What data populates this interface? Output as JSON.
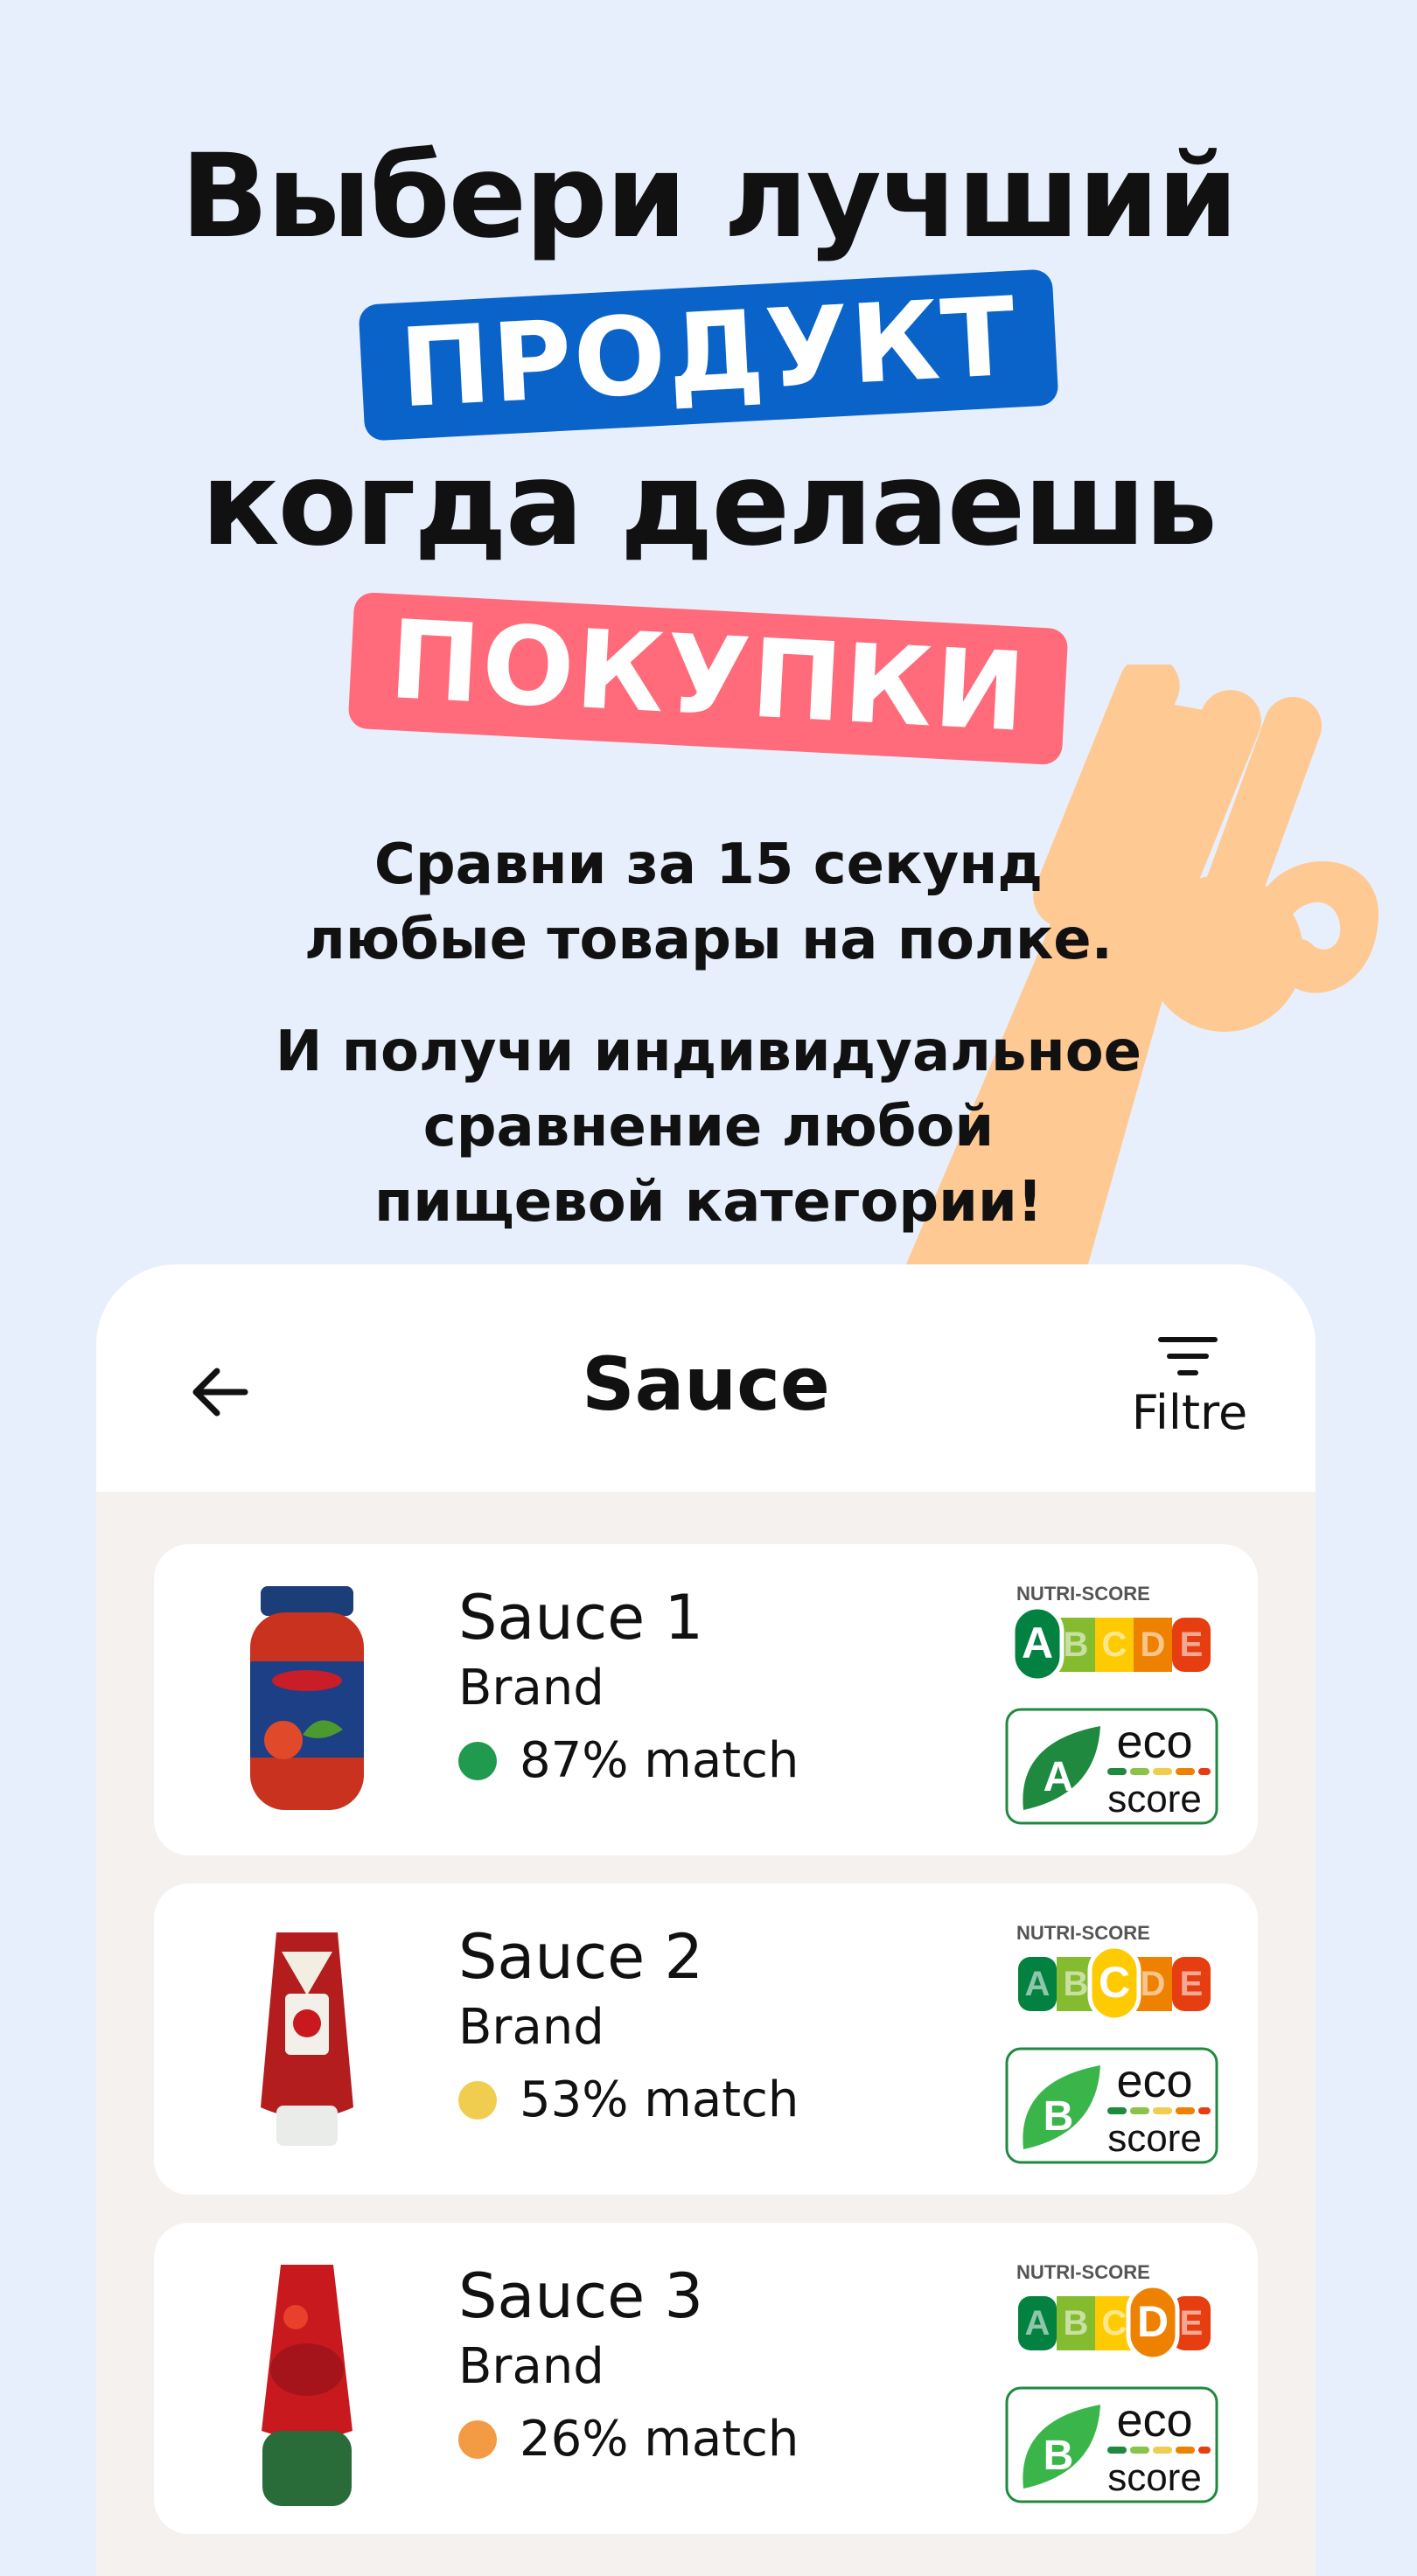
{
  "headline": {
    "line1": "Выбери лучший",
    "pill1": "ПРОДУКТ",
    "line3": "когда делаешь",
    "pill2": "ПОКУПКИ"
  },
  "subtitle1": [
    "Сравни за 15 секунд",
    "любые товары на полке."
  ],
  "subtitle2": [
    "И получи индивидуальное",
    "сравнение любой",
    "пищевой категории!"
  ],
  "colors": {
    "background": "#e8effc",
    "pill_blue": "#0a63c9",
    "pill_red": "#ff6b7a",
    "hand": "#fec992",
    "match_high": "#1f9a4f",
    "match_mid": "#f1cd4f",
    "match_low": "#f39a44"
  },
  "app": {
    "back_icon": "arrow-left-icon",
    "title": "Sauce",
    "filter_icon": "filter-lines-icon",
    "filter_label": "Filtre",
    "products": [
      {
        "name": "Sauce 1",
        "brand": "Brand",
        "match": "87% match",
        "match_color": "#1f9a4f",
        "nutri_label": "NUTRI-SCORE",
        "nutri_grade": "A",
        "eco_grade": "A",
        "eco_text": "eco",
        "eco_sub": "score",
        "image": "pasta-sauce-jar-icon"
      },
      {
        "name": "Sauce 2",
        "brand": "Brand",
        "match": "53% match",
        "match_color": "#f1cd4f",
        "nutri_label": "NUTRI-SCORE",
        "nutri_grade": "C",
        "eco_grade": "B",
        "eco_text": "eco",
        "eco_sub": "score",
        "image": "ketchup-bottle-icon"
      },
      {
        "name": "Sauce 3",
        "brand": "Brand",
        "match": "26% match",
        "match_color": "#f39a44",
        "nutri_label": "NUTRI-SCORE",
        "nutri_grade": "D",
        "eco_grade": "B",
        "eco_text": "eco",
        "eco_sub": "score",
        "image": "ketchup-squeeze-bottle-icon"
      }
    ]
  }
}
